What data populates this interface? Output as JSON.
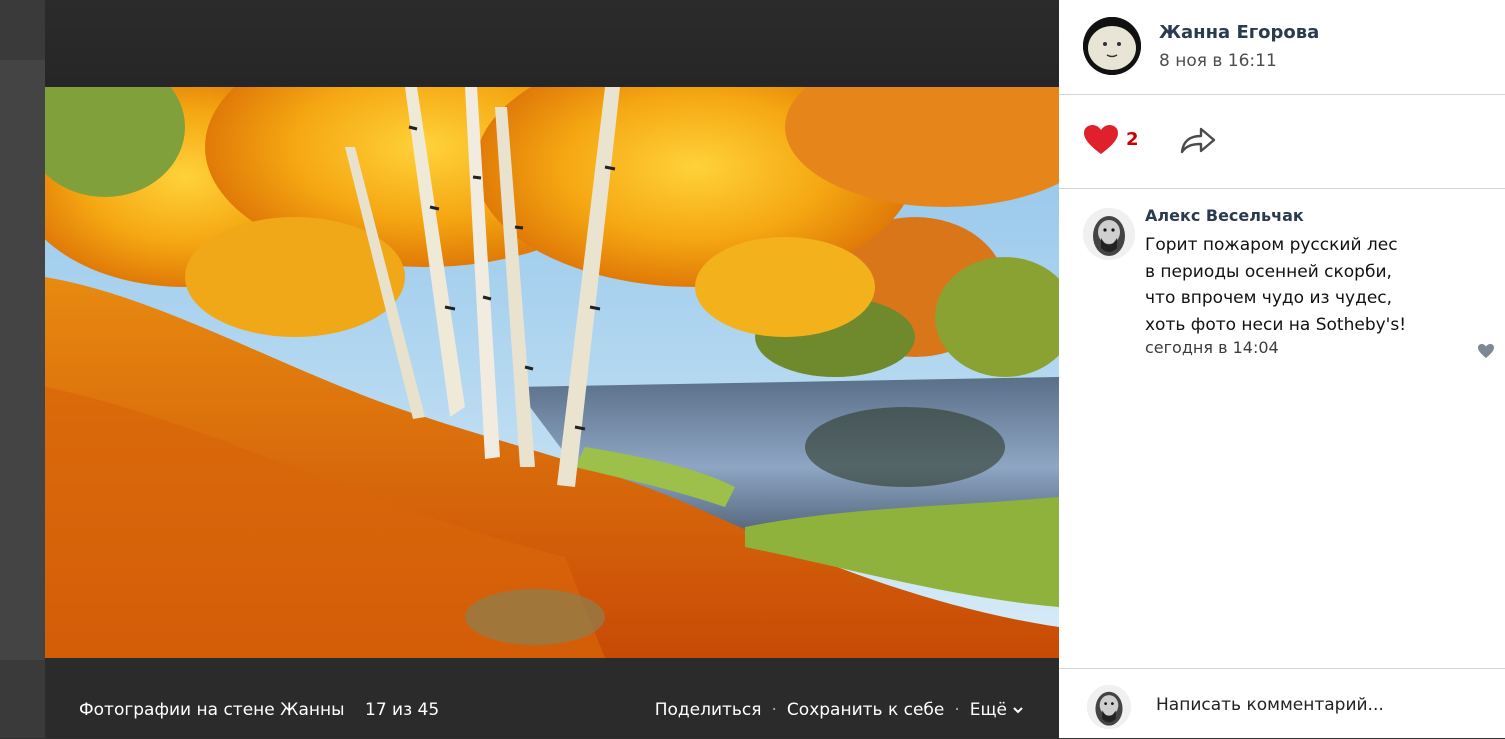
{
  "viewer": {
    "album_title": "Фотографии на стене Жанны",
    "counter": "17 из 45",
    "actions": {
      "share": "Поделиться",
      "save": "Сохранить к себе",
      "more": "Ещё"
    }
  },
  "post": {
    "author_name": "Жанна Егорова",
    "date": "8 ноя в 16:11",
    "likes": "2"
  },
  "comments": [
    {
      "author": "Алекс Весельчак",
      "lines": [
        "Горит пожаром русский лес",
        "в периоды осенней скорби,",
        "что впрочем чудо из чудес,",
        "хоть фото неси на Sotheby's!"
      ],
      "date": "сегодня в 14:04"
    }
  ],
  "composer": {
    "placeholder": "Написать комментарий..."
  },
  "colors": {
    "like_red": "#e0202a",
    "name_blue": "#2a3a4f",
    "viewer_bg": "#2b2b2b"
  },
  "icons": [
    "heart-icon",
    "share-arrow-icon",
    "chevron-down-icon",
    "comment-like-icon"
  ]
}
